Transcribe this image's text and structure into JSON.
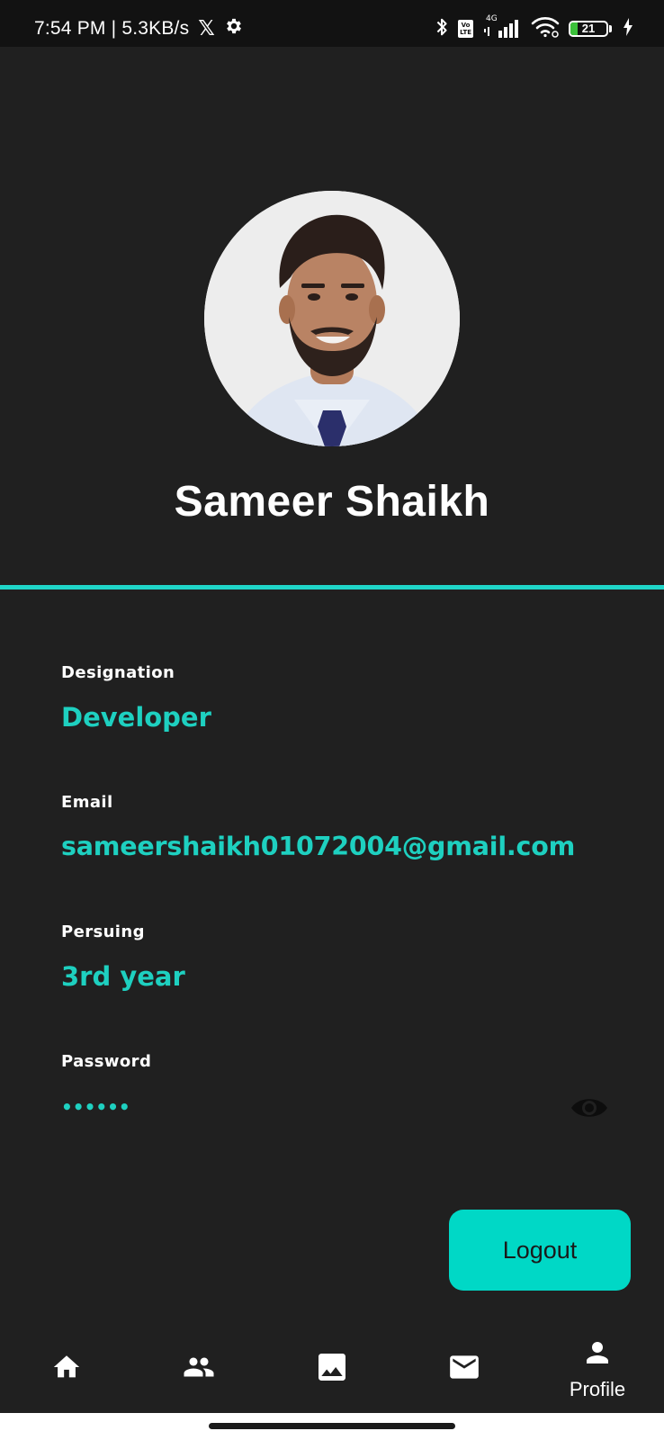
{
  "status_bar": {
    "time": "7:54 PM",
    "separator": " | ",
    "net_speed": "5.3KB/s",
    "x_glyph": "𝕏",
    "volte_top": "Vo",
    "volte_bottom": "LTE",
    "network_type": "4G",
    "battery_level": "21",
    "battery_fraction": 0.21,
    "icons": [
      "bluetooth-icon",
      "volte-icon",
      "signal-icon",
      "wifi-icon",
      "battery-icon",
      "charging-icon",
      "x-logo-icon",
      "gear-icon"
    ]
  },
  "profile": {
    "name": "Sameer Shaikh",
    "avatar_icon": "profile-photo"
  },
  "fields": {
    "designation_label": "Designation",
    "designation_value": "Developer",
    "email_label": "Email",
    "email_value": "sameershaikh01072004@gmail.com",
    "pursuing_label": "Persuing",
    "pursuing_value": "3rd year",
    "password_label": "Password",
    "password_mask": "••••••"
  },
  "actions": {
    "logout_label": "Logout"
  },
  "bottom_nav": {
    "items": [
      {
        "icon": "home-icon",
        "label": ""
      },
      {
        "icon": "people-icon",
        "label": ""
      },
      {
        "icon": "image-icon",
        "label": ""
      },
      {
        "icon": "mail-icon",
        "label": ""
      },
      {
        "icon": "person-icon",
        "label": "Profile"
      }
    ]
  },
  "colors": {
    "background": "#202020",
    "accent": "#1ed0c0",
    "button": "#00d8c6",
    "text": "#ffffff"
  }
}
